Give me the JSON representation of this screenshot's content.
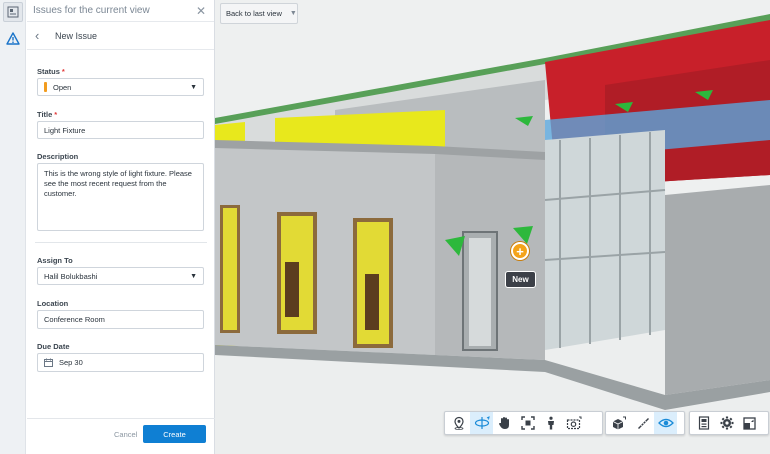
{
  "panel": {
    "header_title": "Issues for the current view",
    "close_glyph": "✕",
    "back_glyph": "‹",
    "subheader_title": "New Issue"
  },
  "form": {
    "status_label": "Status",
    "status_value": "Open",
    "status_color": "#f29c1f",
    "title_label": "Title",
    "title_value": "Light Fixture",
    "description_label": "Description",
    "description_value": "This is the wrong style of light fixture. Please see the most recent request from the customer.",
    "assign_label": "Assign To",
    "assign_value": "Halil Bolukbashi",
    "location_label": "Location",
    "location_value": "Conference Room",
    "due_label": "Due Date",
    "due_value": "Sep 30",
    "required_mark": "*",
    "caret": "▼"
  },
  "footer": {
    "cancel_label": "Cancel",
    "create_label": "Create"
  },
  "viewport": {
    "back_to_last_view": "Back to last view",
    "back_caret": "▼",
    "marker_glyph": "+",
    "new_tag": "New"
  },
  "toolbar_groups": [
    [
      "location-pin-icon",
      "orbit-icon",
      "pan-hand-icon",
      "fit-view-icon",
      "first-person-icon",
      "camera-icon"
    ],
    [
      "explode-model-icon",
      "measure-icon",
      "visibility-eye-icon"
    ],
    [
      "model-browser-icon",
      "settings-gear-icon",
      "fullscreen-icon"
    ]
  ],
  "colors": {
    "accent_blue": "#0f7fd3",
    "marker_orange": "#f4a31a",
    "wall_yellow": "#e8e81c",
    "wall_red": "#c8202a",
    "light_fixture_green": "#2db83c"
  }
}
